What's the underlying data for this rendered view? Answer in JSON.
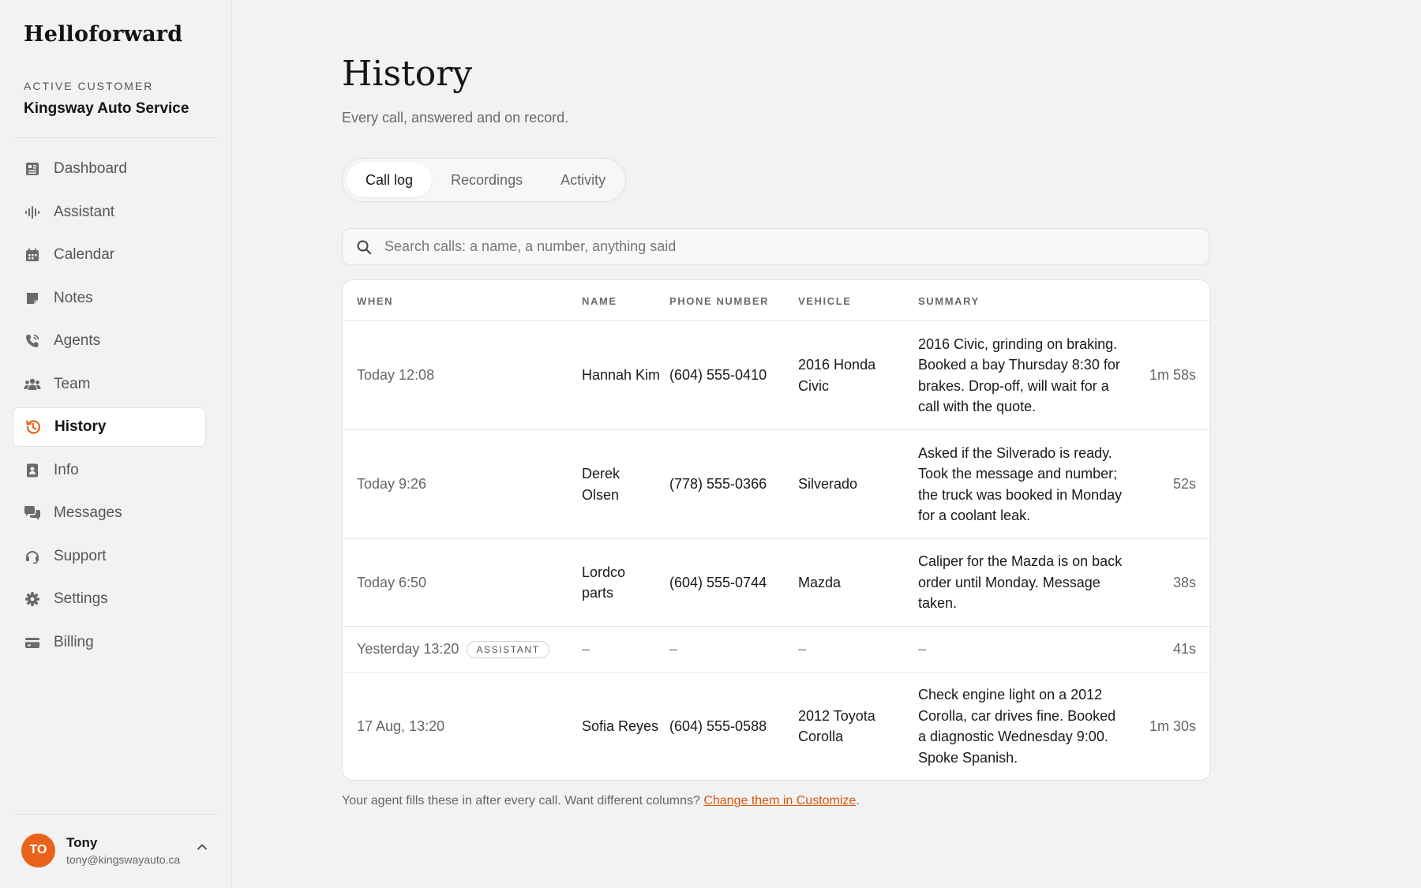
{
  "app": {
    "brand": "Helloforward"
  },
  "sidebar": {
    "customer_label": "ACTIVE CUSTOMER",
    "customer_name": "Kingsway Auto Service",
    "items": [
      {
        "label": "Dashboard",
        "icon": "dashboard-icon"
      },
      {
        "label": "Assistant",
        "icon": "waveform-icon"
      },
      {
        "label": "Calendar",
        "icon": "calendar-icon"
      },
      {
        "label": "Notes",
        "icon": "note-icon"
      },
      {
        "label": "Agents",
        "icon": "phone-icon"
      },
      {
        "label": "Team",
        "icon": "team-icon"
      },
      {
        "label": "History",
        "icon": "history-icon",
        "active": true
      },
      {
        "label": "Info",
        "icon": "contact-card-icon"
      },
      {
        "label": "Messages",
        "icon": "chat-icon"
      },
      {
        "label": "Support",
        "icon": "headset-icon"
      },
      {
        "label": "Settings",
        "icon": "gear-icon"
      },
      {
        "label": "Billing",
        "icon": "credit-card-icon"
      }
    ],
    "user": {
      "initials": "TO",
      "name": "Tony",
      "email": "tony@kingswayauto.ca"
    }
  },
  "main": {
    "title": "History",
    "subtitle": "Every call, answered and on record.",
    "tabs": [
      {
        "label": "Call log",
        "active": true
      },
      {
        "label": "Recordings"
      },
      {
        "label": "Activity"
      }
    ],
    "search": {
      "placeholder": "Search calls: a name, a number, anything said",
      "value": ""
    },
    "table": {
      "columns": {
        "when": "WHEN",
        "name": "NAME",
        "phone": "PHONE NUMBER",
        "vehicle": "VEHICLE",
        "summary": "SUMMARY"
      },
      "rows": [
        {
          "when": "Today 12:08",
          "name": "Hannah Kim",
          "phone": "(604) 555-0410",
          "vehicle": "2016 Honda Civic",
          "summary": "2016 Civic, grinding on braking. Booked a bay Thursday 8:30 for brakes. Drop-off, will wait for a call with the quote.",
          "duration": "1m 58s",
          "badge": ""
        },
        {
          "when": "Today 9:26",
          "name": "Derek Olsen",
          "phone": "(778) 555-0366",
          "vehicle": "Silverado",
          "summary": "Asked if the Silverado is ready. Took the message and number; the truck was booked in Monday for a coolant leak.",
          "duration": "52s",
          "badge": ""
        },
        {
          "when": "Today 6:50",
          "name": "Lordco parts",
          "phone": "(604) 555-0744",
          "vehicle": "Mazda",
          "summary": "Caliper for the Mazda is on back order until Monday. Message taken.",
          "duration": "38s",
          "badge": ""
        },
        {
          "when": "Yesterday 13:20",
          "name": "–",
          "phone": "–",
          "vehicle": "–",
          "summary": "–",
          "duration": "41s",
          "badge": "ASSISTANT"
        },
        {
          "when": "17 Aug, 13:20",
          "name": "Sofia Reyes",
          "phone": "(604) 555-0588",
          "vehicle": "2012 Toyota Corolla",
          "summary": "Check engine light on a 2012 Corolla, car drives fine. Booked a diagnostic Wednesday 9:00. Spoke Spanish.",
          "duration": "1m 30s",
          "badge": ""
        }
      ]
    },
    "footnote": {
      "text": "Your agent fills these in after every call. Want different columns?",
      "link": "Change them in Customize",
      "suffix": "."
    }
  },
  "colors": {
    "accent": "#e8621b",
    "link": "#d4570f",
    "background": "#f2f2f3"
  }
}
